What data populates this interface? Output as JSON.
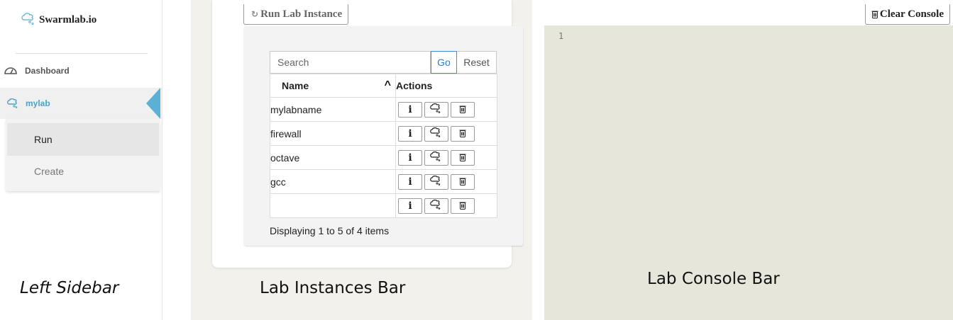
{
  "sidebar": {
    "logo_text": "Swarmlab.io",
    "nav": {
      "dashboard": {
        "label": "Dashboard",
        "icon": "dashboard-gauge-icon"
      },
      "mylab": {
        "label": "mylab",
        "icon": "swarmlab-cloud-icon"
      }
    },
    "submenu": {
      "run": "Run",
      "create": "Create"
    },
    "caption": "Left Sidebar"
  },
  "instances": {
    "run_button_label": "Run Lab Instance",
    "run_button_icon": "restart-icon",
    "search": {
      "placeholder": "Search",
      "value": ""
    },
    "go_label": "Go",
    "reset_label": "Reset",
    "columns": {
      "name": "Name",
      "actions": "Actions"
    },
    "sort_icon": "sort-ascending-icon",
    "rows": [
      {
        "name": "mylabname"
      },
      {
        "name": "firewall"
      },
      {
        "name": "octave"
      },
      {
        "name": "gcc"
      },
      {
        "name": ""
      }
    ],
    "action_icons": {
      "info": "i",
      "connect": "swarmlab-cloud-icon",
      "delete": "trash-icon"
    },
    "footer": "Displaying 1 to 5 of 4 items",
    "caption": "Lab Instances Bar"
  },
  "console": {
    "clear_button_label": "Clear Console",
    "clear_button_icon": "trash-icon",
    "line_number": "1",
    "caption": "Lab Console Bar"
  },
  "colors": {
    "accent": "#4aa3c9",
    "instances_bg": "#f2f1ec",
    "console_bg": "#e6e6da",
    "go_blue": "#2b7fd1"
  }
}
